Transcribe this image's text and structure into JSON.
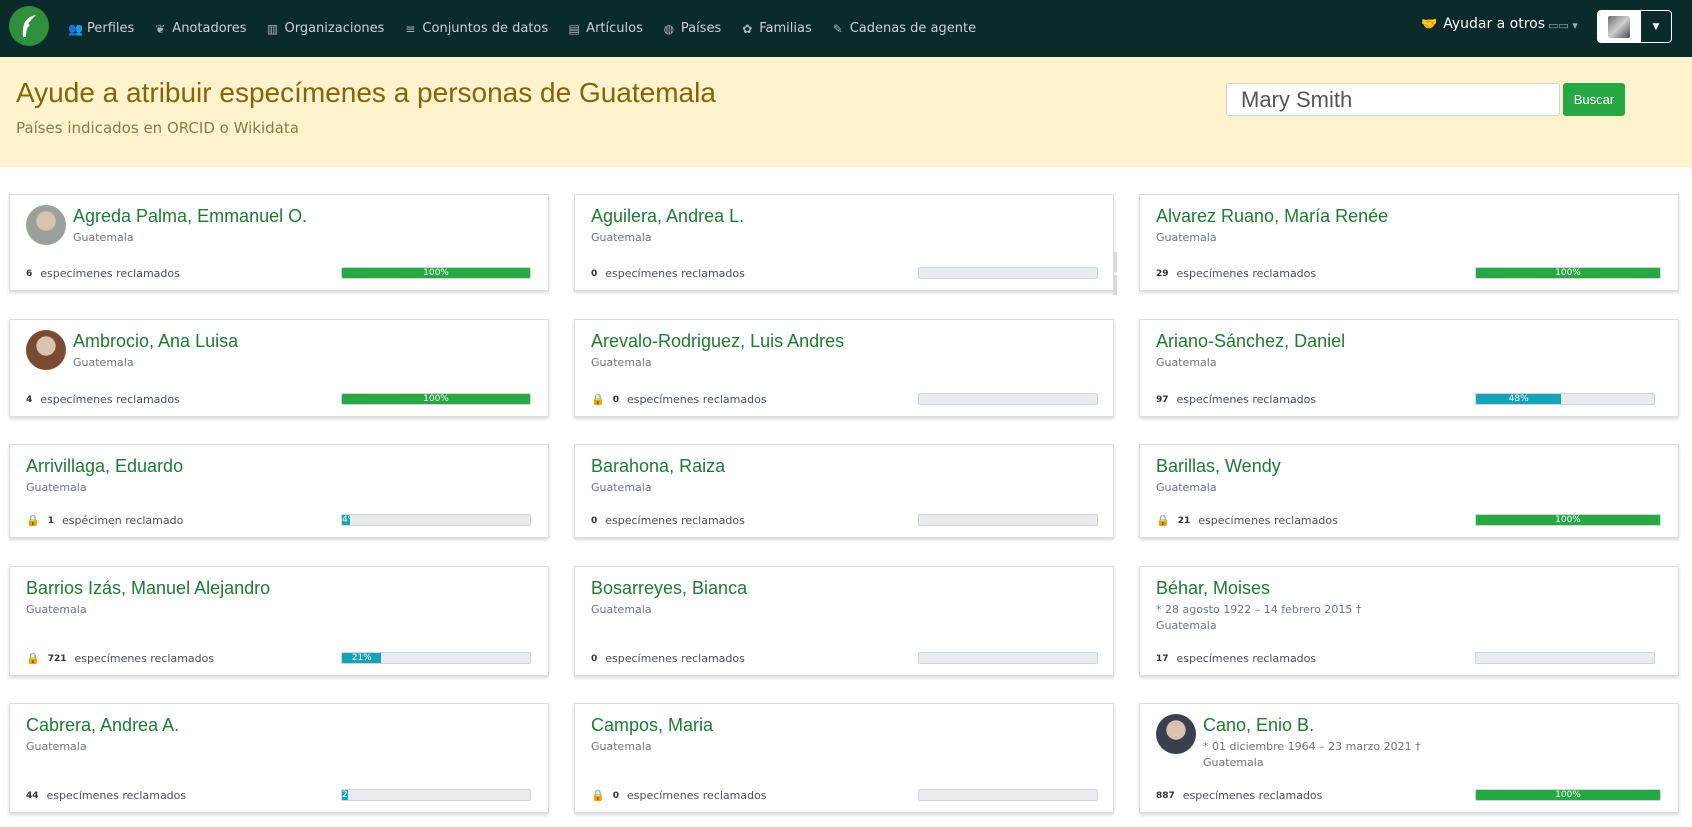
{
  "colors": {
    "navbar": "#0b2a2a",
    "hero_bg": "#fff3cd",
    "hero_title": "#856404",
    "name": "#1f7a34",
    "bar_green": "#28a745",
    "bar_teal": "#17a2b8"
  },
  "nav": {
    "items": [
      {
        "label": "Perfiles",
        "icon": "users-icon"
      },
      {
        "label": "Anotadores",
        "icon": "leaf-icon"
      },
      {
        "label": "Organizaciones",
        "icon": "building-icon"
      },
      {
        "label": "Conjuntos de datos",
        "icon": "database-icon"
      },
      {
        "label": "Artículos",
        "icon": "file-icon"
      },
      {
        "label": "Países",
        "icon": "globe-icon"
      },
      {
        "label": "Familias",
        "icon": "pagelines-icon"
      },
      {
        "label": "Cadenas de agente",
        "icon": "signature-icon"
      }
    ],
    "help_label": "Ayudar a otros"
  },
  "hero": {
    "title": "Ayude a atribuir especímenes a personas de Guatemala",
    "subtitle": "Países indicados en ORCID o Wikidata",
    "search_placeholder": "Mary Smith",
    "search_button": "Buscar"
  },
  "cards": [
    {
      "name": "Agreda Palma, Emmanuel O.",
      "country": "Guatemala",
      "count": "6",
      "label": "especímenes reclamados",
      "pct": 100,
      "pct_label": "100%",
      "avatar": true,
      "avatar_color": "#9aa09a",
      "locked": false
    },
    {
      "name": "Aguilera, Andrea L.",
      "country": "Guatemala",
      "count": "0",
      "label": "especímenes reclamados",
      "pct": 0,
      "pct_label": "",
      "locked": false
    },
    {
      "name": "Alvarez Ruano, María Renée",
      "country": "Guatemala",
      "count": "29",
      "label": "especímenes reclamados",
      "pct": 100,
      "pct_label": "100%",
      "locked": false
    },
    {
      "name": "Ambrocio, Ana Luisa",
      "country": "Guatemala",
      "count": "4",
      "label": "especímenes reclamados",
      "pct": 100,
      "pct_label": "100%",
      "avatar": true,
      "avatar_color": "#7a4a34",
      "locked": false
    },
    {
      "name": "Arevalo-Rodriguez, Luis Andres",
      "country": "Guatemala",
      "count": "0",
      "label": "especímenes reclamados",
      "pct": 0,
      "pct_label": "",
      "locked": true
    },
    {
      "name": "Ariano-Sánchez, Daniel",
      "country": "Guatemala",
      "count": "97",
      "label": "especímenes reclamados",
      "pct": 48,
      "pct_label": "48%",
      "locked": false
    },
    {
      "name": "Arrivillaga, Eduardo",
      "country": "Guatemala",
      "count": "1",
      "label": "espécimen reclamado",
      "pct": 4,
      "pct_label": "4%",
      "locked": true
    },
    {
      "name": "Barahona, Raiza",
      "country": "Guatemala",
      "count": "0",
      "label": "especímenes reclamados",
      "pct": 0,
      "pct_label": "",
      "locked": false
    },
    {
      "name": "Barillas, Wendy",
      "country": "Guatemala",
      "count": "21",
      "label": "especímenes reclamados",
      "pct": 100,
      "pct_label": "100%",
      "locked": true
    },
    {
      "name": "Barrios Izás, Manuel Alejandro",
      "country": "Guatemala",
      "count": "721",
      "label": "especímenes reclamados",
      "pct": 21,
      "pct_label": "21%",
      "locked": true
    },
    {
      "name": "Bosarreyes, Bianca",
      "country": "Guatemala",
      "count": "0",
      "label": "especímenes reclamados",
      "pct": 0,
      "pct_label": "",
      "locked": false
    },
    {
      "name": "Béhar, Moises",
      "dates": "* 28 agosto 1922 – 14 febrero 2015 †",
      "country": "Guatemala",
      "count": "17",
      "label": "especímenes reclamados",
      "pct": 0,
      "pct_label": "",
      "locked": false
    },
    {
      "name": "Cabrera, Andrea A.",
      "country": "Guatemala",
      "count": "44",
      "label": "especímenes reclamados",
      "pct": 2,
      "pct_label": "2%",
      "locked": false
    },
    {
      "name": "Campos, Maria",
      "country": "Guatemala",
      "count": "0",
      "label": "especímenes reclamados",
      "pct": 0,
      "pct_label": "",
      "locked": true
    },
    {
      "name": "Cano, Enio B.",
      "dates": "* 01 diciembre 1964 – 23 marzo 2021 †",
      "country": "Guatemala",
      "count": "887",
      "label": "especímenes reclamados",
      "pct": 100,
      "pct_label": "100%",
      "avatar": true,
      "avatar_color": "#3a4050",
      "locked": false
    }
  ]
}
